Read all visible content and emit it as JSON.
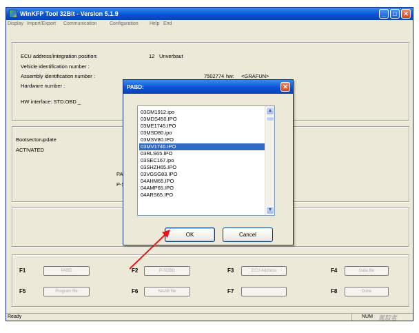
{
  "window": {
    "title": "WinKFP Tool 32Bit - Version 5.1.9",
    "minimize_glyph": "_",
    "maximize_glyph": "□",
    "close_glyph": "✕"
  },
  "menu": [
    "Display",
    "Import/Export",
    "Communication",
    "Configuration",
    "Help",
    "End"
  ],
  "info": {
    "ecu_label": "ECU address/integration position:",
    "ecu_value": "12",
    "ecu_state": "Unverbaut",
    "vin_label": "Vehicle identification number :",
    "assembly_label": "Assembly identification number :",
    "assembly_value": "7502774",
    "assembly_state": "hw:",
    "assembly_extra": "<GRAFUN>",
    "hardware_label": "Hardware number :",
    "hw_interface": "HW interface: STD:OBD _"
  },
  "mid": {
    "boot_label": "Bootsectorupdate",
    "activated": "ACTIVATED",
    "pab_label": "PAB",
    "ps_label": "P-S"
  },
  "fkeys": [
    {
      "key": "F1",
      "label": "PABD"
    },
    {
      "key": "F2",
      "label": "P-SGBD"
    },
    {
      "key": "F3",
      "label": "ECU Address"
    },
    {
      "key": "F4",
      "label": "Data file"
    },
    {
      "key": "F5",
      "label": "Program file"
    },
    {
      "key": "F6",
      "label": "NAAB file"
    },
    {
      "key": "F7",
      "label": ""
    },
    {
      "key": "F8",
      "label": "Done"
    }
  ],
  "status": {
    "ready": "Ready",
    "num": "NUM",
    "watermark": "駕馭者"
  },
  "dialog": {
    "title": "PABD:",
    "close_glyph": "✕",
    "items": [
      "03GM1912.ipo",
      "03MDS450.IPO",
      "03ME1745.IPO",
      "03MSD80.ipo",
      "03MSV80.IPO",
      "03MV1746.IPO",
      "03RLS65.IPO",
      "03SEC167.ipo",
      "03SHZH65.IPO",
      "03VGSG83.IPO",
      "04AHM65.IPO",
      "04AMP65.IPO",
      "04ARS65.IPO"
    ],
    "selected_index": 5,
    "ok_label": "OK",
    "cancel_label": "Cancel",
    "scroll_up": "▲",
    "scroll_down": "▼"
  },
  "colors": {
    "annotation_arrow": "#e8161c",
    "selection": "#316ac5",
    "titlebar": "#0a54d8"
  }
}
